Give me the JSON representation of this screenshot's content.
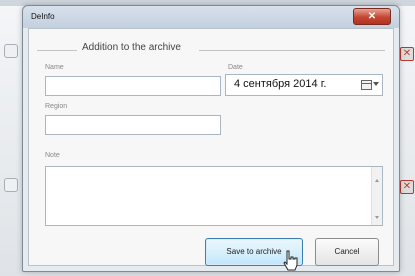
{
  "window": {
    "title": "DeInfo",
    "close_glyph": "✕"
  },
  "group": {
    "title": "Addition to the archive"
  },
  "form": {
    "name_label": "Name",
    "name_value": "",
    "date_label": "Date",
    "date_value": "4 сентября 2014 г.",
    "region_label": "Region",
    "region_value": "",
    "note_label": "Note",
    "note_value": ""
  },
  "buttons": {
    "save_label": "Save to archive",
    "cancel_label": "Cancel"
  },
  "icons": {
    "calendar": "calendar-icon",
    "dropdown": "chevron-down-icon",
    "cursor": "hand-pointer-icon"
  },
  "colors": {
    "close_button": "#c54632",
    "primary_button_border": "#3c7fb1"
  }
}
